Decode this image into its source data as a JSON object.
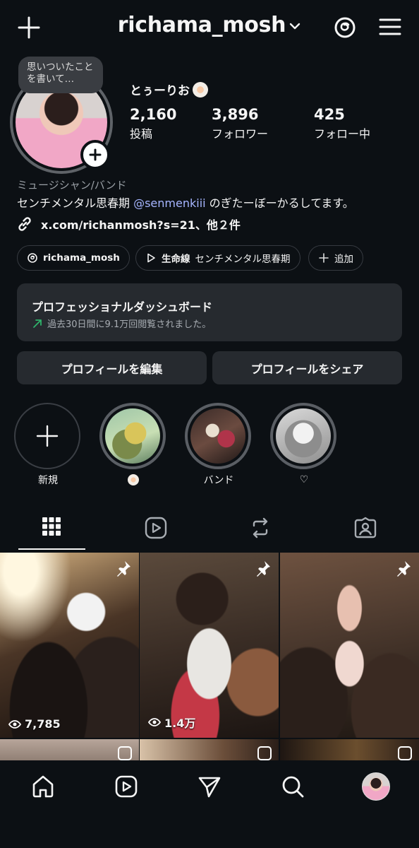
{
  "header": {
    "username": "richama_mosh",
    "icons": [
      "plus-icon",
      "chevron-down-icon",
      "threads-icon",
      "hamburger-menu-icon"
    ]
  },
  "profile": {
    "note": "思いついたことを書いて…",
    "display_name": "とぅーりお",
    "stats": [
      {
        "value": "2,160",
        "label": "投稿"
      },
      {
        "value": "3,896",
        "label": "フォロワー"
      },
      {
        "value": "425",
        "label": "フォロー中"
      }
    ],
    "category": "ミュージシャン/バンド",
    "bio_prefix": "センチメンタル思春期 ",
    "bio_mention": "@senmenkiii",
    "bio_suffix": " のぎたーぼーかるしてます。",
    "link": "x.com/richanmosh?s=21、他２件"
  },
  "pills": {
    "threads": "richama_mosh",
    "music_bold": "生命線",
    "music_artist": "センチメンタル思春期",
    "add": "追加"
  },
  "dashboard": {
    "title": "プロフェッショナルダッシュボード",
    "subtitle": "過去30日間に9.1万回閲覧されました。",
    "accent": "#2fb36b"
  },
  "buttons": {
    "edit": "プロフィールを編集",
    "share": "プロフィールをシェア"
  },
  "highlights": [
    {
      "label": "新規"
    },
    {
      "label": ""
    },
    {
      "label": "バンド"
    },
    {
      "label": "♡"
    }
  ],
  "tabs": [
    "grid-icon",
    "reels-icon",
    "reposts-icon",
    "tagged-icon"
  ],
  "posts": [
    {
      "views": "7,785",
      "pinned": true
    },
    {
      "views": "1.4万",
      "pinned": true
    },
    {
      "views": "",
      "pinned": true
    }
  ],
  "bottom_nav": [
    "home-icon",
    "reels-icon",
    "send-icon",
    "search-icon",
    "profile-avatar"
  ]
}
